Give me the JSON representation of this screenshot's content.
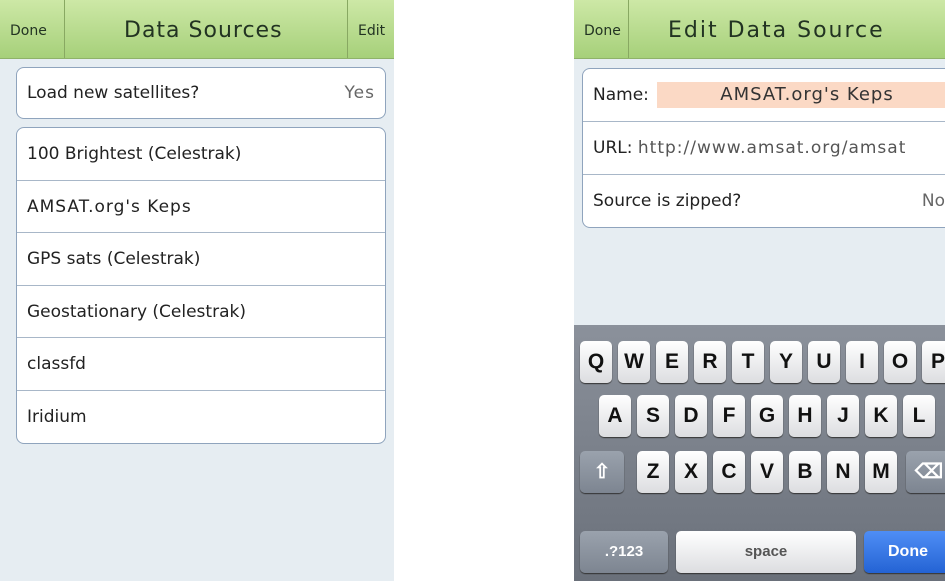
{
  "left": {
    "nav": {
      "done_label": "Done",
      "title": "Data Sources",
      "edit_label": "Edit"
    },
    "load_row": {
      "label": "Load new satellites?",
      "value": "Yes"
    },
    "sources": [
      "100 Brightest (Celestrak)",
      "AMSAT.org's Keps",
      "GPS sats (Celestrak)",
      "Geostationary (Celestrak)",
      "classfd",
      "Iridium"
    ]
  },
  "right": {
    "nav": {
      "done_label": "Done",
      "title": "Edit Data Source"
    },
    "name_label": "Name:",
    "name_value": "AMSAT.org's Keps",
    "url_label": "URL:",
    "url_value": "http://www.amsat.org/amsat",
    "zipped_label": "Source is zipped?",
    "zipped_value": "No"
  },
  "keyboard": {
    "row1": [
      "Q",
      "W",
      "E",
      "R",
      "T",
      "Y",
      "U",
      "I",
      "O",
      "P"
    ],
    "row2": [
      "A",
      "S",
      "D",
      "F",
      "G",
      "H",
      "J",
      "K",
      "L"
    ],
    "row3": [
      "Z",
      "X",
      "C",
      "V",
      "B",
      "N",
      "M"
    ],
    "numbers_label": ".?123",
    "space_label": "space",
    "done_label": "Done",
    "shift_icon": "shift-arrow-icon",
    "backspace_icon": "backspace-icon"
  }
}
